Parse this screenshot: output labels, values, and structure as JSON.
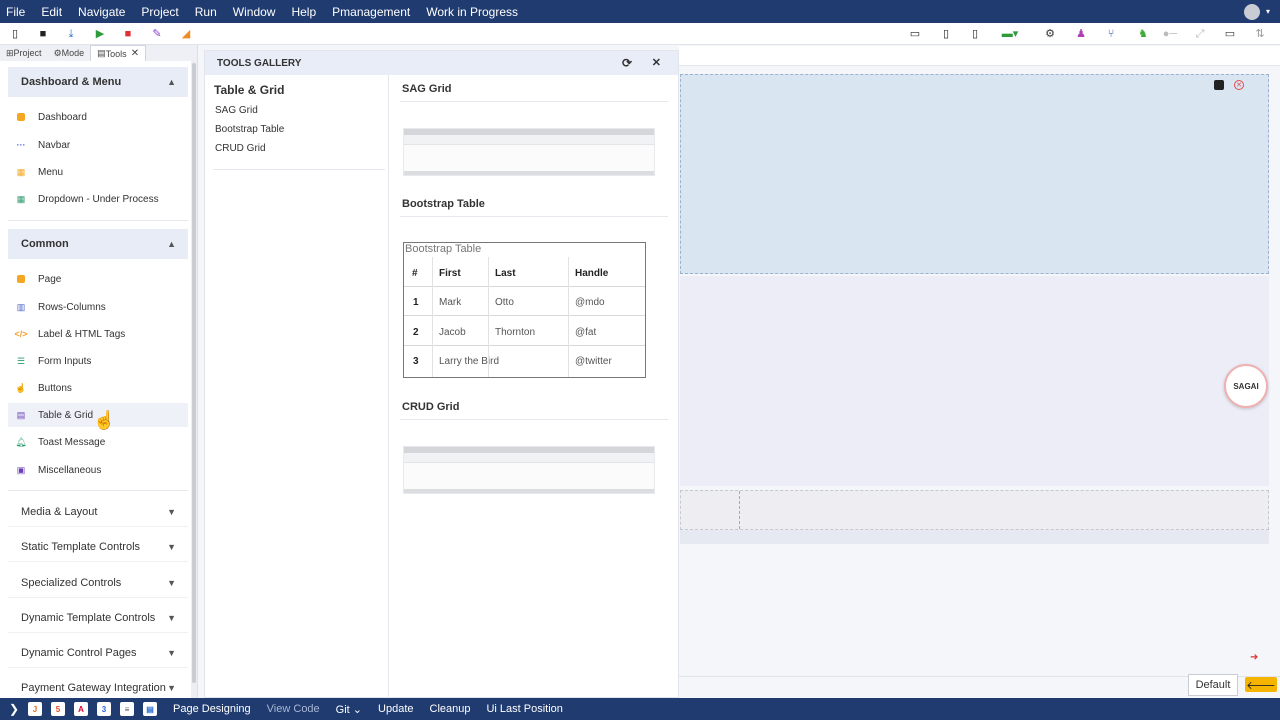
{
  "menubar": {
    "items": [
      "File",
      "Edit",
      "Navigate",
      "Project",
      "Run",
      "Window",
      "Help",
      "Pmanagement",
      "Work in Progress"
    ]
  },
  "left_panel": {
    "tabs": [
      {
        "label": "Project",
        "icon": "project-icon"
      },
      {
        "label": "Mode",
        "icon": "mode-icon"
      },
      {
        "label": "Tools",
        "icon": "tools-icon",
        "active": true,
        "close": "✕"
      }
    ],
    "sections": {
      "dashboard": {
        "title": "Dashboard & Menu",
        "items": [
          {
            "label": "Dashboard",
            "icon": "dashboard-icon",
            "color": "#f5a623"
          },
          {
            "label": "Navbar",
            "icon": "navbar-icon",
            "color": "#5a6bd8"
          },
          {
            "label": "Menu",
            "icon": "menu-icon",
            "color": "#f5a623"
          },
          {
            "label": "Dropdown - Under Process",
            "icon": "dropdown-icon",
            "color": "#2e9a6b"
          }
        ]
      },
      "common": {
        "title": "Common",
        "items": [
          {
            "label": "Page",
            "icon": "page-icon",
            "color": "#f5a623"
          },
          {
            "label": "Rows-Columns",
            "icon": "rows-columns-icon",
            "color": "#4a63c7"
          },
          {
            "label": "Label & HTML Tags",
            "icon": "code-icon",
            "color": "#f0a030"
          },
          {
            "label": "Form Inputs",
            "icon": "form-icon",
            "color": "#2e9a6b"
          },
          {
            "label": "Buttons",
            "icon": "hand-icon",
            "color": "#4a63c7"
          },
          {
            "label": "Table & Grid",
            "icon": "table-icon",
            "color": "#6a3fb5"
          },
          {
            "label": "Toast Message",
            "icon": "bell-icon",
            "color": "#2e9a6b"
          },
          {
            "label": "Miscellaneous",
            "icon": "misc-icon",
            "color": "#6a3fb5"
          }
        ]
      },
      "collapsed": [
        "Media & Layout",
        "Static Template Controls",
        "Specialized Controls",
        "Dynamic Template Controls",
        "Dynamic Control Pages",
        "Payment Gateway Integration"
      ]
    }
  },
  "gallery": {
    "header": "TOOLS GALLERY",
    "left_title": "Table & Grid",
    "links": [
      "SAG Grid",
      "Bootstrap Table",
      "CRUD Grid"
    ],
    "sections": [
      "SAG Grid",
      "Bootstrap Table",
      "CRUD Grid"
    ],
    "bootstrap_table": {
      "caption": "Bootstrap Table",
      "headers": [
        "#",
        "First",
        "Last",
        "Handle"
      ],
      "rows": [
        [
          "1",
          "Mark",
          "Otto",
          "@mdo"
        ],
        [
          "2",
          "Jacob",
          "Thornton",
          "@fat"
        ],
        [
          "3",
          "Larry the Bird",
          "",
          "@twitter"
        ]
      ]
    }
  },
  "canvas": {
    "saga_label": "SAGAI",
    "default_button": "Default",
    "back_arrow": "🡐"
  },
  "statusbar": {
    "items": [
      "Page Designing",
      "View Code",
      "Git",
      "Update",
      "Cleanup",
      "Ui Last Position"
    ],
    "git_suffix": " ⌄"
  }
}
